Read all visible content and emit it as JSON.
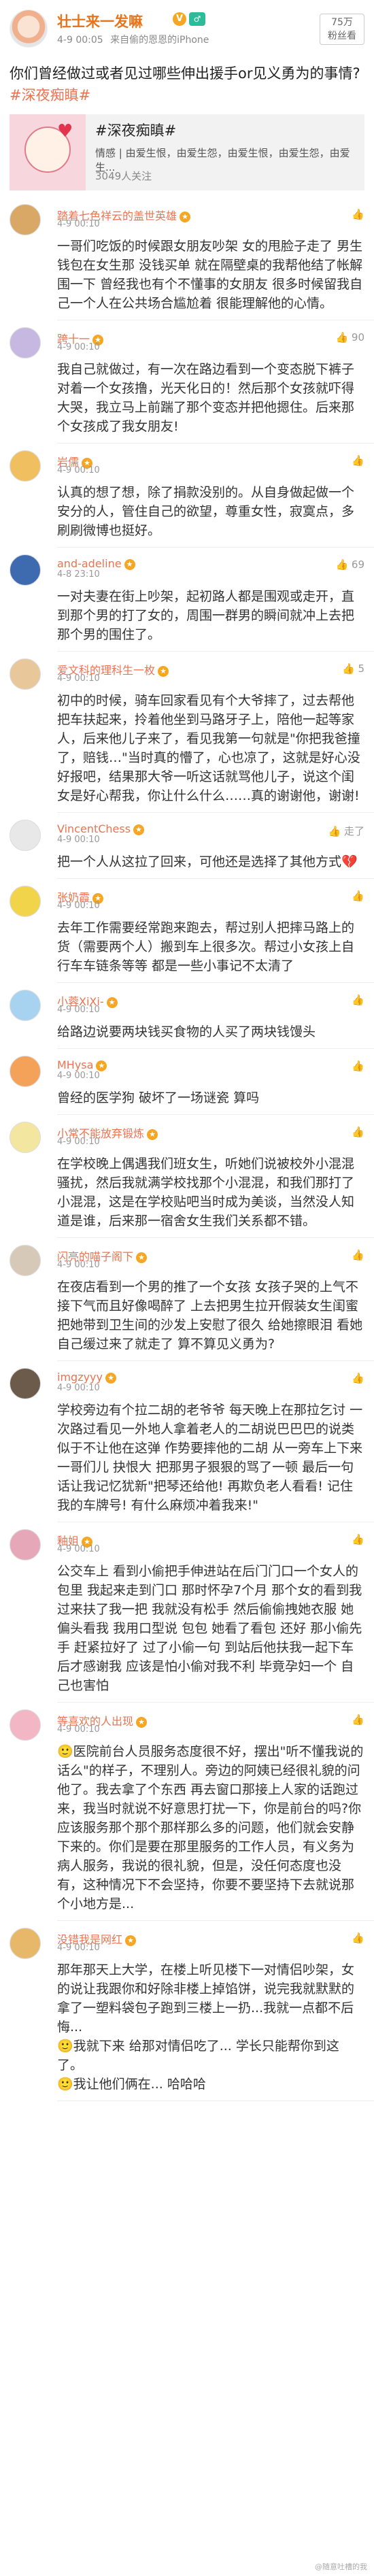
{
  "post": {
    "author": "壮士来一发嘛",
    "badge_v": "V",
    "badge_g": "♂",
    "time": "4-9 00:05",
    "source": "来自偷的恩恩的iPhone",
    "follow_count": "75万",
    "follow_label": "粉丝看",
    "text": "你们曾经做过或者见过哪些伸出援手or见义勇为的事情?",
    "hashtag": "#深夜痴瞋#",
    "card": {
      "title": "#深夜痴瞋#",
      "tags": "情感 | 由爱生恨，由爱生怨，由爱生恨，由爱生怨，由爱生...",
      "count": "3049人关注"
    }
  },
  "comments": [
    {
      "name": "踏着七色祥云的盖世英雄",
      "time": "4-9 00:10",
      "likes": "",
      "text": "一哥们吃饭的时候跟女朋友吵架 女的甩脸子走了 男生钱包在女生那 没钱买单 就在隔壁桌的我帮他结了帐解围一下 曾经我也有个不懂事的女朋友 很多时候留我自己一个人在公共场合尴尬着 很能理解他的心情。",
      "avatar_color": "#d9a866"
    },
    {
      "name": "跨十一",
      "time": "4-9 00:10",
      "likes": "90",
      "text": "我自己就做过，有一次在路边看到一个变态脱下裤子对着一个女孩撸，光天化日的！然后那个女孩就吓得大哭，我立马上前踹了那个变态并把他摁住。后来那个女孩成了我女朋友!",
      "avatar_color": "#c7b8e2"
    },
    {
      "name": "岩儒",
      "time": "4-9 00:10",
      "likes": "",
      "text": "认真的想了想，除了捐款没别的。从自身做起做一个安分的人，管住自己的欲望，尊重女性，寂寞点，多刷刷微博也挺好。",
      "avatar_color": "#f0c060"
    },
    {
      "name": "and-adeline",
      "time": "4-8 23:10",
      "likes": "69",
      "text": "一对夫妻在街上吵架，起初路人都是围观或走开，直到那个男的打了女的，周围一群男的瞬间就冲上去把那个男的围住了。",
      "avatar_color": "#3e6bb0"
    },
    {
      "name": "爱文科的理科生一枚",
      "time": "4-9 00:10",
      "likes": "5",
      "text": "初中的时候，骑车回家看见有个大爷摔了，过去帮他把车扶起来，拎着他坐到马路牙子上，陪他一起等家人，后来他儿子来了，看见我第一句就是\"你把我爸撞了，赔钱…\"当时真的懵了，心也凉了，这就是好心没好报吧，结果那大爷一听这话就骂他儿子，说这个闺女是好心帮我，你让什么什么……真的谢谢他，谢谢!",
      "avatar_color": "#e8c79a"
    },
    {
      "name": "VincentChess",
      "time": "4-9 00:10",
      "likes": "走了",
      "text": "把一个人从这拉了回来，可他还是选择了其他方式💔",
      "avatar_color": "#e8e8e8"
    },
    {
      "name": "张奶霞",
      "time": "4-9 00:10",
      "likes": "",
      "text": "去年工作需要经常跑来跑去，帮过别人把摔马路上的货（需要两个人）搬到车上很多次。帮过小女孩上自行车车链条等等 都是一些小事记不太清了",
      "avatar_color": "#f1d44a"
    },
    {
      "name": "小蓉XiXi-",
      "time": "4-9 00:10",
      "likes": "",
      "text": "给路边说要两块钱买食物的人买了两块钱馒头",
      "avatar_color": "#a7d3f0"
    },
    {
      "name": "MHysa",
      "time": "4-9 00:10",
      "likes": "",
      "text": "曾经的医学狗  破坏了一场谜瓷  算吗",
      "avatar_color": "#f4a25a"
    },
    {
      "name": "小常不能放弃锻炼",
      "time": "4-9 00:10",
      "likes": "",
      "text": "在学校晚上偶遇我们班女生，听她们说被校外小混混骚扰，然后我就满学校找那个小混混，和我们那打了小混混，这是在学校贴吧当时成为美谈，当然没人知道是谁，后来那一宿舍女生我们关系都不错。",
      "avatar_color": "#f2e6a0"
    },
    {
      "name": "闪亮的喵子阁下",
      "time": "4-9 00:10",
      "likes": "",
      "text": "在夜店看到一个男的推了一个女孩 女孩子哭的上气不接下气而且好像喝醉了 上去把男生拉开假装女生闺蜜把她带到卫生间的沙发上安慰了很久 给她擦眼泪 看她自己缓过来了就走了 算不算见义勇为?",
      "avatar_color": "#d6c9b8"
    },
    {
      "name": "imgzyyy",
      "time": "4-9 00:10",
      "likes": "",
      "text": "学校旁边有个拉二胡的老爷爷 每天晚上在那拉乞讨 一次路过看见一外地人拿着老人的二胡说巴巴巴的说类似于不让他在这弹 作势要摔他的二胡 从一旁车上下来一哥们儿 抉恨大 把那男子狠狠的骂了一顿 最后一句话让我记忆犹新\"把琴还给他! 再欺负老人看看! 记住我的车牌号! 有什么麻烦冲着我来!\"",
      "avatar_color": "#6c5b4a"
    },
    {
      "name": "釉姐",
      "time": "4-9 00:10",
      "likes": "",
      "text": "公交车上 看到小偷把手伸进站在后门门口一个女人的包里 我起来走到门口 那时怀孕7个月 那个女的看到我过来扶了我一把 我就没有松手 然后偷偷拽她衣服 她偏头看我 我用口型说 包包 她看了看包 还好 那小偷先手 赶紧拉好了 过了小偷一句 到站后他扶我一起下车后才感谢我 应该是怕小偷对我不利 毕竟孕妇一个 自己也害怕",
      "avatar_color": "#e6a8b8"
    },
    {
      "name": "等喜欢的人出现",
      "time": "4-9 00:10",
      "likes": "",
      "text": "🙂医院前台人员服务态度很不好，摆出\"听不懂我说的话么\"的样子，不理别人。旁边的阿姨已经很礼貌的问他了。我去拿了个东西 再去窗口那接上人家的话跑过来，我当时就说不好意思打扰一下，你是前台的吗?你应该服务那个那个那样那么多的问题，他们就会安静下来的。你们是要在那里服务的工作人员，有义务为病人服务，我说的很礼貌，但是，没任何态度也没有，这种情况下不会坚持，你要不要坚持下去就说那个小地方是...",
      "avatar_color": "#f3b6c4"
    },
    {
      "name": "没错我是网红",
      "time": "4-9 00:10",
      "likes": "",
      "text": "那年那天上大学，在楼上听见楼下一对情侣吵架，女的说让我跟你和好除非楼上掉馅饼，说完我就默默的拿了一塑料袋包子跑到三楼上一扔...我就一点都不后悔...\n🙂我就下来 给那对情侣吃了... 学长只能帮你到这了。\n🙂我让他们俩在... 哈哈哈",
      "avatar_color": "#e8b86a"
    }
  ],
  "watermark": "@随意吐槽的我"
}
